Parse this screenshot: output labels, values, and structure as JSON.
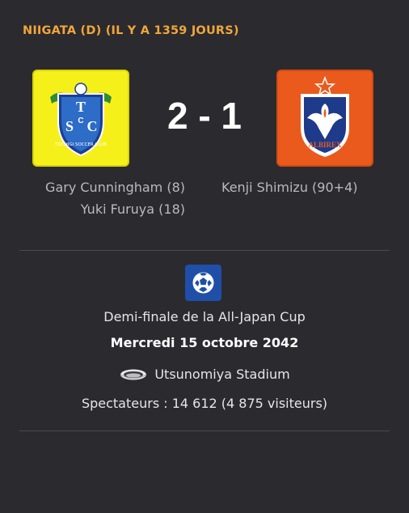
{
  "match": {
    "header": "NIIGATA (D) (IL Y A 1359 JOURS)",
    "score": "2 - 1",
    "home": {
      "badge_icon": "tochigi-sc-crest-icon",
      "badge_text": "TOCHIGI SOCCER CLUB",
      "badge_letters": "TSC",
      "badge_color": "#f6f01a",
      "scorers": [
        "Gary Cunningham (8)",
        "Yuki Furuya (18)"
      ]
    },
    "away": {
      "badge_icon": "albirex-niigata-crest-icon",
      "badge_text": "ALBIREX",
      "badge_color": "#ea5a1c",
      "scorers": [
        "Kenji Shimizu (90+4)"
      ]
    }
  },
  "details": {
    "competition_icon": "all-japan-cup-icon",
    "competition": "Demi-finale de la All-Japan Cup",
    "date": "Mercredi 15 octobre 2042",
    "stadium_icon": "stadium-icon",
    "venue": "Utsunomiya Stadium",
    "attendance": "Spectateurs : 14 612 (4 875 visiteurs)"
  },
  "colors": {
    "background": "#2b2a2e",
    "header_accent": "#f0a63a",
    "score_text": "#ffffff",
    "scorer_text": "#b9b9bf"
  }
}
